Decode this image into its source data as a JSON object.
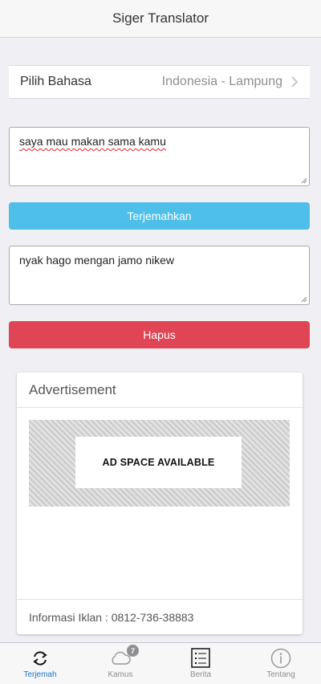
{
  "app": {
    "title": "Siger Translator"
  },
  "language": {
    "label": "Pilih Bahasa",
    "value": "Indonesia - Lampung",
    "icon": "chevron-right-icon"
  },
  "input": {
    "value": "saya mau makan sama kamu"
  },
  "translate_button": {
    "label": "Terjemahkan",
    "color": "#4dbfe8"
  },
  "output": {
    "value": "nyak hago mengan jamo nikew"
  },
  "clear_button": {
    "label": "Hapus",
    "color": "#e04555"
  },
  "advertisement": {
    "title": "Advertisement",
    "banner_text": "AD SPACE AVAILABLE",
    "footer": "Informasi Iklan : 0812-736-38883"
  },
  "tabs": [
    {
      "label": "Terjemah",
      "icon": "refresh-icon",
      "active": true
    },
    {
      "label": "Kamus",
      "icon": "cloud-icon",
      "badge": "7",
      "active": false
    },
    {
      "label": "Berita",
      "icon": "list-icon",
      "active": false
    },
    {
      "label": "Tentang",
      "icon": "info-icon",
      "active": false
    }
  ],
  "colors": {
    "accent": "#1a73c9",
    "inactive": "#8e8e93"
  }
}
